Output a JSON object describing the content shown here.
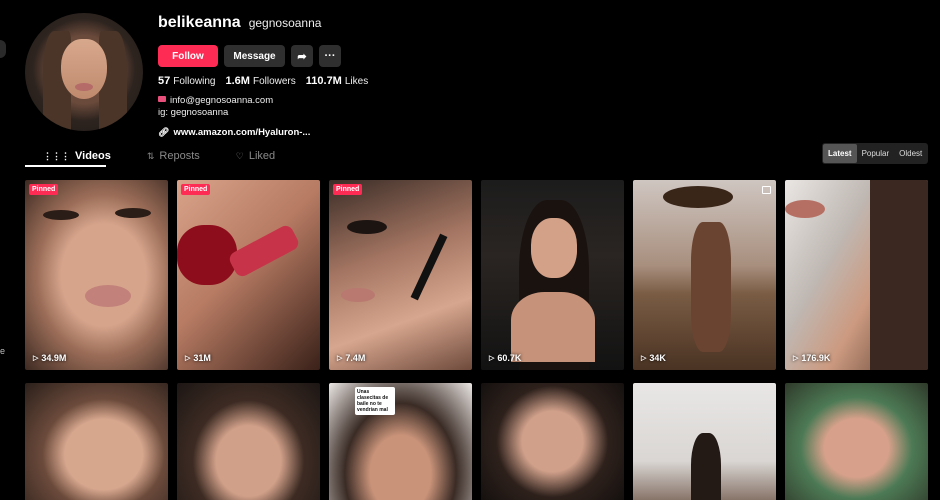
{
  "profile": {
    "username": "belikeanna",
    "nickname": "gegnosoanna",
    "follow_label": "Follow",
    "message_label": "Message",
    "share_icon": "share-icon",
    "more_label": "···",
    "stats": {
      "following": "57",
      "following_label": "Following",
      "followers": "1.6M",
      "followers_label": "Followers",
      "likes": "110.7M",
      "likes_label": "Likes"
    },
    "bio_lines": [
      "info@gegnosoanna.com",
      "ig: gegnosoanna"
    ],
    "link": "www.amazon.com/Hyaluron-..."
  },
  "tabs": [
    {
      "label": "Videos",
      "icon": "grid-icon"
    },
    {
      "label": "Reposts",
      "icon": "repost-icon"
    },
    {
      "label": "Liked",
      "icon": "heart-icon"
    }
  ],
  "sort": [
    "Latest",
    "Popular",
    "Oldest"
  ],
  "left_edge_text": "e",
  "videos": [
    {
      "views": "34.9M",
      "pinned": "Pinned"
    },
    {
      "views": "31M",
      "pinned": "Pinned"
    },
    {
      "views": "7.4M",
      "pinned": "Pinned"
    },
    {
      "views": "60.7K"
    },
    {
      "views": "34K"
    },
    {
      "views": "176.9K"
    }
  ],
  "row2_caption": "Unas clasecitas de baile no te vendrían mal",
  "colors": {
    "accent": "#fe2c55",
    "background": "#000000"
  }
}
